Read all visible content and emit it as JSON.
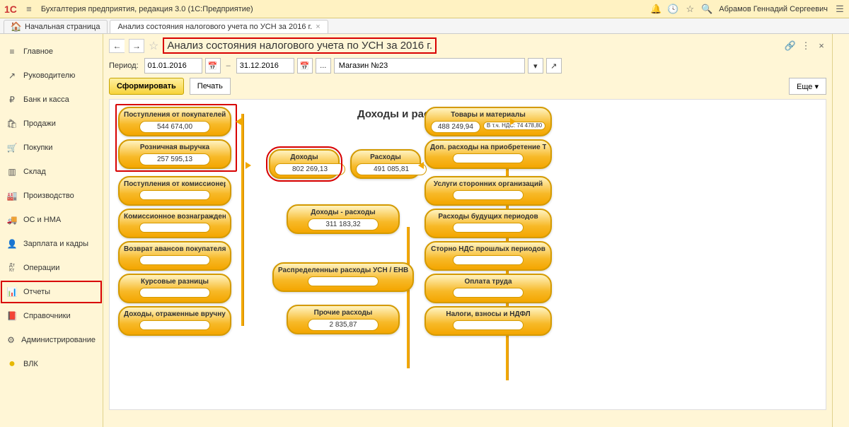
{
  "header": {
    "menu_glyph": "≡",
    "app_title": "Бухгалтерия предприятия, редакция 3.0  (1С:Предприятие)",
    "user": "Абрамов Геннадий Сергеевич"
  },
  "tabs": {
    "home": "Начальная страница",
    "current": "Анализ состояния налогового учета по УСН за 2016 г."
  },
  "sidebar": [
    {
      "icon": "≡",
      "label": "Главное"
    },
    {
      "icon": "↗",
      "label": "Руководителю"
    },
    {
      "icon": "₽",
      "label": "Банк и касса"
    },
    {
      "icon": "🛍",
      "label": "Продажи"
    },
    {
      "icon": "🛒",
      "label": "Покупки"
    },
    {
      "icon": "▥",
      "label": "Склад"
    },
    {
      "icon": "🏭",
      "label": "Производство"
    },
    {
      "icon": "🚚",
      "label": "ОС и НМА"
    },
    {
      "icon": "👤",
      "label": "Зарплата и кадры"
    },
    {
      "icon": "Дт\nКт",
      "label": "Операции"
    },
    {
      "icon": "📊",
      "label": "Отчеты"
    },
    {
      "icon": "📕",
      "label": "Справочники"
    },
    {
      "icon": "⚙",
      "label": "Администрирование"
    },
    {
      "icon": "●",
      "label": "ВЛК"
    }
  ],
  "page": {
    "title": "Анализ состояния налогового учета по УСН за 2016 г.",
    "period_label": "Период:",
    "date_from": "01.01.2016",
    "date_to": "31.12.2016",
    "org": "Магазин №23",
    "btn_form": "Сформировать",
    "btn_print": "Печать",
    "btn_more": "Еще"
  },
  "diagram": {
    "title": "Доходы и расходы УСН",
    "left": [
      {
        "title": "Поступления от покупателей",
        "value": "544 674,00",
        "red": true
      },
      {
        "title": "Розничная выручка",
        "value": "257 595,13",
        "red": true
      },
      {
        "title": "Поступления от комиссионеров",
        "value": ""
      },
      {
        "title": "Комиссионное вознаграждение",
        "value": ""
      },
      {
        "title": "Возврат авансов покупателям",
        "value": ""
      },
      {
        "title": "Курсовые разницы",
        "value": ""
      },
      {
        "title": "Доходы, отраженные вручную",
        "value": ""
      }
    ],
    "center": [
      {
        "title": "Доходы",
        "value": "802 269,13",
        "red": true
      },
      {
        "title": "Расходы",
        "value": "491 085,81"
      },
      {
        "title": "Доходы - расходы",
        "value": "311 183,32"
      },
      {
        "title": "Распределенные расходы УСН / ЕНВД",
        "value": ""
      },
      {
        "title": "Прочие расходы",
        "value": "2 835,87"
      }
    ],
    "right": [
      {
        "title": "Товары и материалы",
        "value": "488 249,94",
        "extra": "В т.ч. НДС: 74 478,80"
      },
      {
        "title": "Доп. расходы на приобретение ТМЦ",
        "value": ""
      },
      {
        "title": "Услуги сторонних организаций",
        "value": ""
      },
      {
        "title": "Расходы будущих периодов",
        "value": ""
      },
      {
        "title": "Сторно НДС прошлых периодов",
        "value": ""
      },
      {
        "title": "Оплата труда",
        "value": ""
      },
      {
        "title": "Налоги, взносы и НДФЛ",
        "value": ""
      }
    ]
  }
}
